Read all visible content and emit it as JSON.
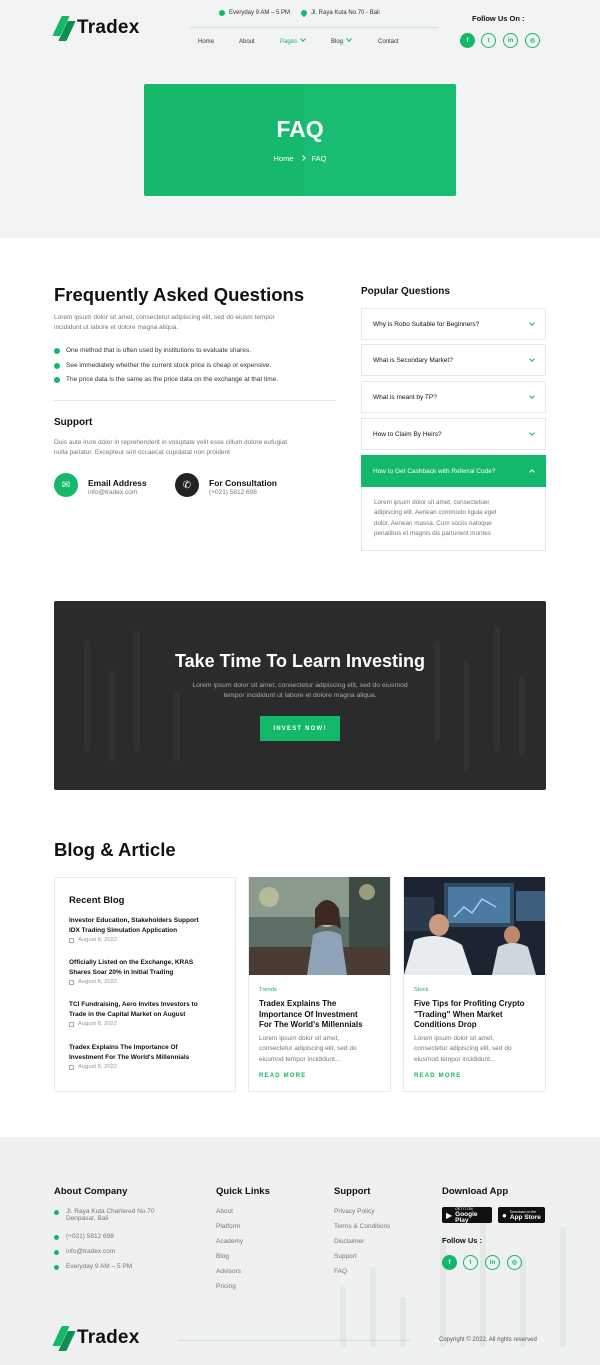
{
  "brand": {
    "name": "Tradex"
  },
  "header": {
    "hours": "Everyday 9 AM – 5 PM",
    "address": "Jl. Raya Kuta No.70 - Bali",
    "follow_label": "Follow Us On :",
    "nav": [
      "Home",
      "About",
      "Pages",
      "Blog",
      "Contact"
    ]
  },
  "social": {
    "facebook": "f",
    "twitter": "t",
    "linkedin": "in",
    "instagram": "◎"
  },
  "banner": {
    "title": "FAQ",
    "crumb_home": "Home",
    "crumb_current": "FAQ"
  },
  "faq": {
    "title": "Frequently Asked Questions",
    "intro_1": "Lorem ipsum dolor sit amet, consectetur adipiscing elit, sed do eiusm tempor",
    "intro_2": "incididunt ut labore et dolore magna aliqua.",
    "checks": [
      "One method that is often used by institutions to evaluate shares.",
      "See immediately whether the current stock price is cheap or expensive.",
      "The price data is the same as the price data on the exchange at that time."
    ],
    "support_title": "Support",
    "support_1": "Duis aute irure dolor in reprehenderit in voluptate velit esse cillum dolore eufugiat",
    "support_2": "nulla pariatur. Excepteur sint occaecat cupidatat non proident",
    "email_label": "Email Address",
    "email_value": "info@tradex.com",
    "consult_label": "For Consultation",
    "consult_value": "(+021) 5812 698"
  },
  "popular": {
    "title": "Popular Questions",
    "questions": [
      "Why is Robo Suitable for Beginners?",
      "What is Secondary Market?",
      "What is meant by TP?",
      "How to Claim By Heirs?",
      "How to Get Cashback with Referral Code?"
    ],
    "answer": [
      "Lorem ipsum dolor sit amet, consectetuer",
      "adipiscing elit. Aenean commodo ligula eget",
      "dolor. Aenean massa. Cum sociis natoque",
      "penatibus et magnis dis parturient montes"
    ]
  },
  "cta": {
    "title": "Take Time To Learn Investing",
    "text_1": "Lorem ipsum dolor sit amet, consectetur adipiscing elit, sed do eiusmod",
    "text_2": "tempor incididunt ut labore et dolore magna aliqua.",
    "button": "INVEST NOW!"
  },
  "blog": {
    "title": "Blog & Article",
    "recent_title": "Recent Blog",
    "recent": [
      {
        "l1": "Investor Education, Stakeholders Support",
        "l2": "IDX Trading Simulation Application",
        "date": "August 8, 2022"
      },
      {
        "l1": "Officially Listed on the Exchange, KRAS",
        "l2": "Shares Soar 20% in Initial Trading",
        "date": "August 8, 2022"
      },
      {
        "l1": "TCI Fundraising, Aero Invites Investors to",
        "l2": "Trade in the Capital Market on August",
        "date": "August 8, 2022"
      },
      {
        "l1": "Tradex Explains The Importance Of",
        "l2": "Investment For The World's Millennials",
        "date": "August 8, 2022"
      }
    ],
    "posts": [
      {
        "tag": "Trends",
        "t1": "Tradex Explains The",
        "t2": "Importance Of Investment",
        "t3": "For The World's Millennials",
        "e1": "Lorem ipsum dolor sit amet,",
        "e2": "consectetur adipiscing elit, sed do",
        "e3": "eiusmod tempor incididunt...",
        "more": "READ MORE"
      },
      {
        "tag": "Stock",
        "t1": "Five Tips for Profiting Crypto",
        "t2": "\"Trading\" When Market",
        "t3": "Conditions Drop",
        "e1": "Lorem ipsum dolor sit amet,",
        "e2": "consectetur adipiscing elit, sed do",
        "e3": "eiusmod tempor incididunt...",
        "more": "READ MORE"
      }
    ]
  },
  "footer": {
    "about_title": "About Company",
    "address_1": "Jl. Raya Kuta Chartered No.70",
    "address_2": "Denpasar, Bali",
    "phone": "(+021) 5812 698",
    "email": "info@tradex.com",
    "hours": "Everyday 9 AM – 5 PM",
    "quick_title": "Quick Links",
    "quick": [
      "About",
      "Platform",
      "Academy",
      "Blog",
      "Advisors",
      "Pricing"
    ],
    "support_title": "Support",
    "support": [
      "Privacy Policy",
      "Terms & Conditions",
      "Disclaimer",
      "Support",
      "FAQ"
    ],
    "download_title": "Download App",
    "google_small": "GET IT ON",
    "google_name": "Google Play",
    "apple_small": "Download on the",
    "apple_name": "App Store",
    "follow_label": "Follow Us :",
    "copyright": "Copyright © 2022. All rights reserved"
  },
  "colors": {
    "accent": "#13b86a",
    "dark": "#2b2b2b"
  }
}
